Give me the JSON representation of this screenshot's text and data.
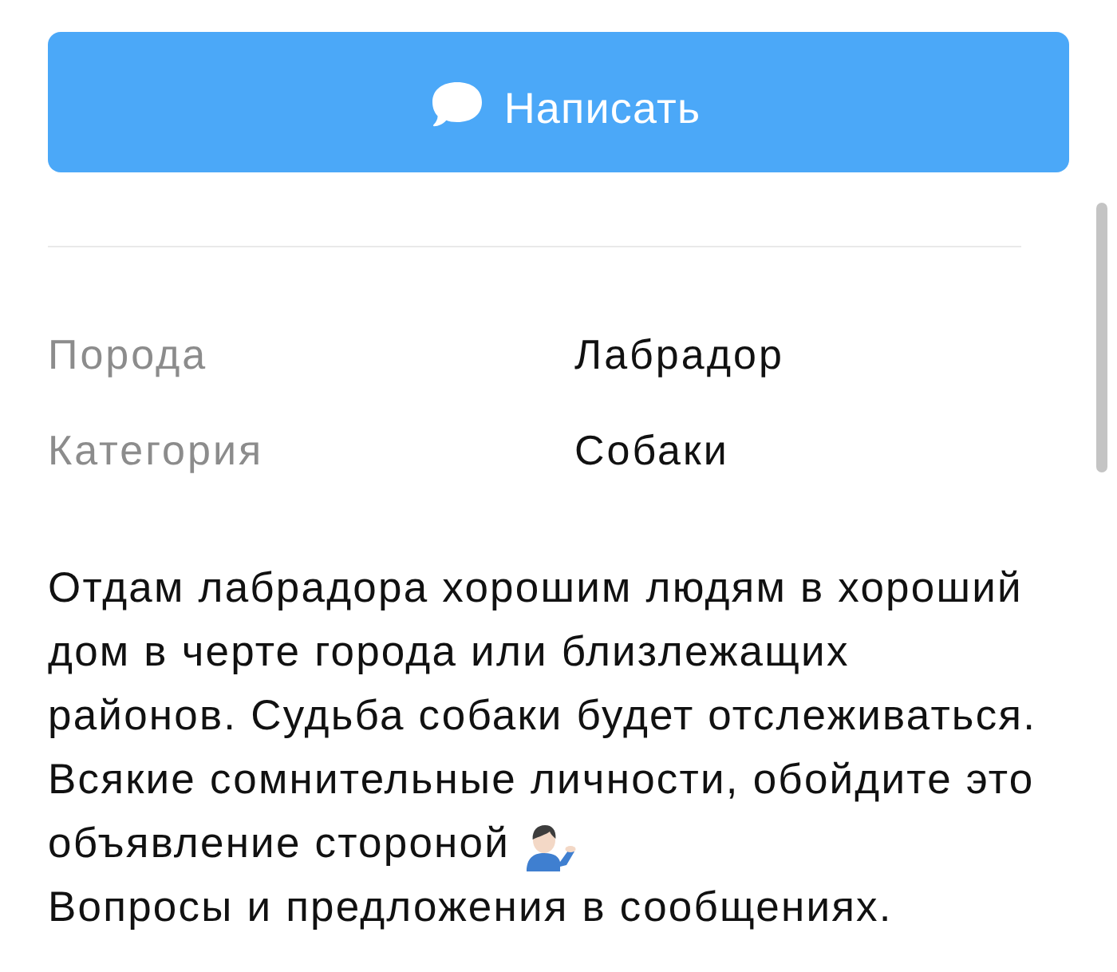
{
  "compose_button": {
    "label": "Написать"
  },
  "attributes": [
    {
      "label": "Порода",
      "value": "Лабрадор"
    },
    {
      "label": "Категория",
      "value": "Собаки"
    }
  ],
  "description": {
    "lines": [
      {
        "text": "Отдам лабрадора хорошим людям в хороший"
      },
      {
        "text": "дом в черте города или близлежащих"
      },
      {
        "text": "районов. Судьба собаки будет отслеживаться."
      },
      {
        "text": "Всякие сомнительные личности, обойдите это"
      },
      {
        "text": "объявление стороной",
        "emoji": true
      },
      {
        "text": "Вопросы и предложения в сообщениях."
      }
    ]
  }
}
